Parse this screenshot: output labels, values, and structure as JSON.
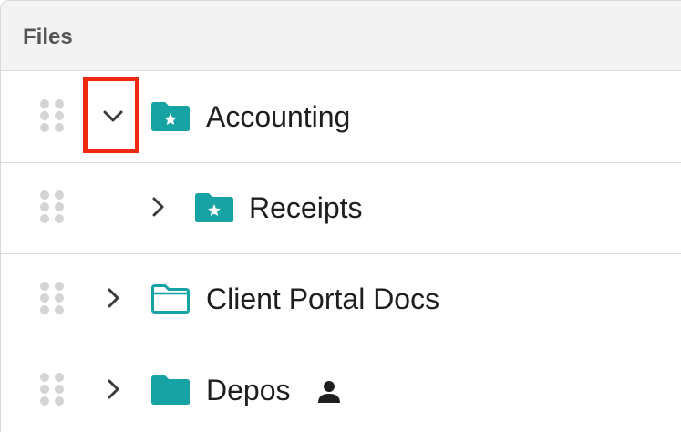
{
  "header": {
    "title": "Files"
  },
  "rows": [
    {
      "label": "Accounting",
      "expanded": true,
      "folder_icon": "folder-star-filled-icon",
      "indent_level": 0
    },
    {
      "label": "Receipts",
      "expanded": false,
      "folder_icon": "folder-star-filled-icon",
      "indent_level": 1
    },
    {
      "label": "Client Portal Docs",
      "expanded": false,
      "folder_icon": "folder-outline-icon",
      "indent_level": 0
    },
    {
      "label": "Depos",
      "expanded": false,
      "folder_icon": "folder-filled-icon",
      "indent_level": 0,
      "badge_icon": "person-icon"
    }
  ],
  "colors": {
    "folder_teal": "#17a3a3",
    "highlight_red": "#ee2b12",
    "grip_gray": "#d4d4d4",
    "header_bg": "#f3f3f3"
  }
}
